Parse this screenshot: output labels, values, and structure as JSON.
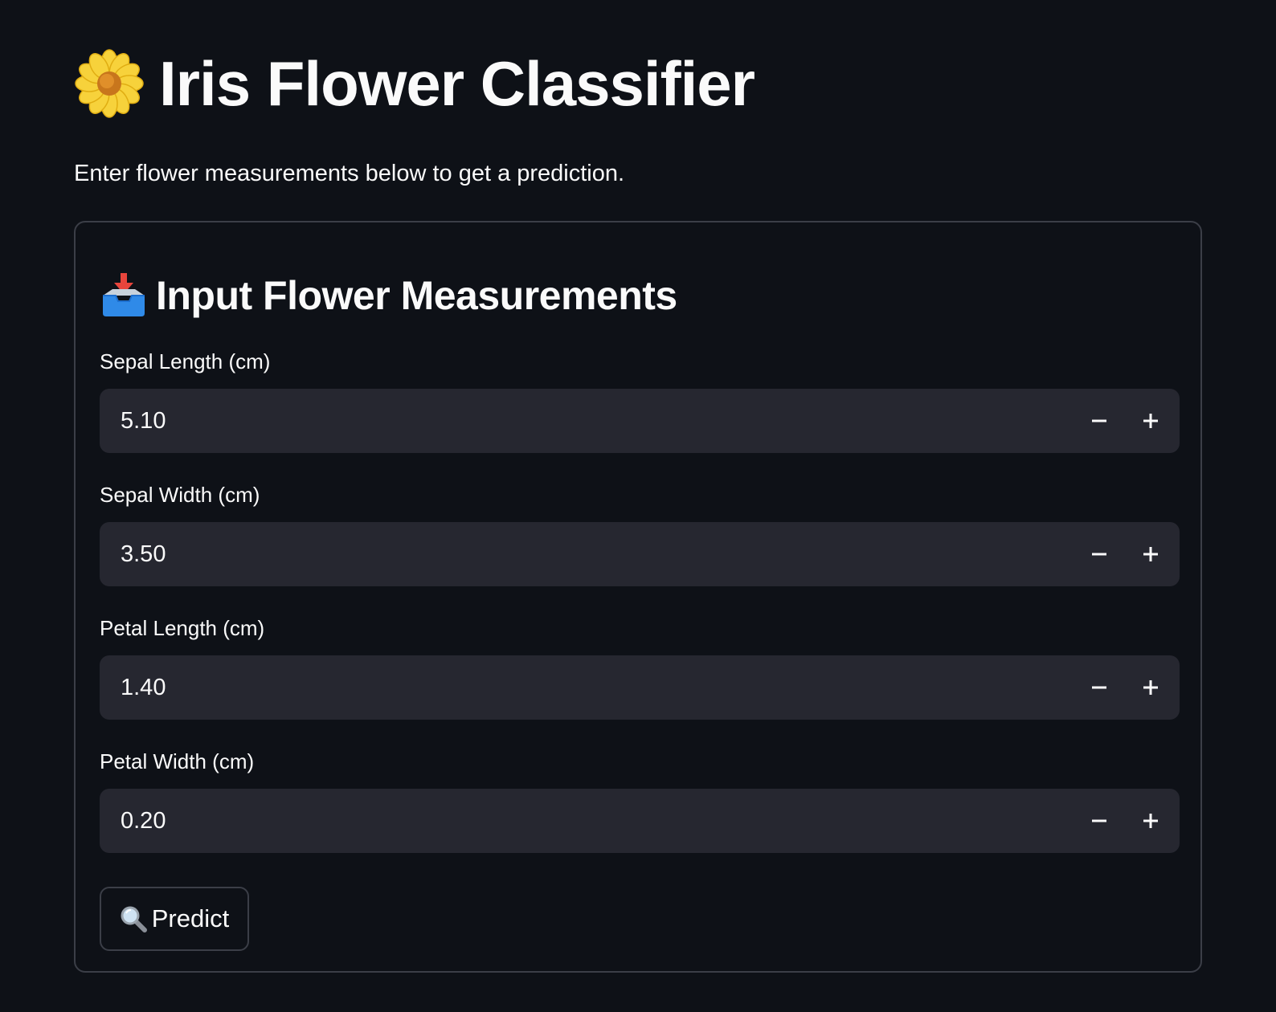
{
  "header": {
    "title": "Iris Flower Classifier",
    "title_icon": "blossom-icon",
    "subtitle": "Enter flower measurements below to get a prediction."
  },
  "form": {
    "section_title": "Input Flower Measurements",
    "section_icon": "inbox-tray-icon",
    "fields": [
      {
        "label": "Sepal Length (cm)",
        "value": "5.10"
      },
      {
        "label": "Sepal Width (cm)",
        "value": "3.50"
      },
      {
        "label": "Petal Length (cm)",
        "value": "1.40"
      },
      {
        "label": "Petal Width (cm)",
        "value": "0.20"
      }
    ],
    "submit": {
      "label": "Predict",
      "icon": "magnifying-glass-icon"
    }
  },
  "colors": {
    "background": "#0e1117",
    "input_background": "#262730",
    "border": "#3b3e47",
    "text": "#fafafa"
  }
}
